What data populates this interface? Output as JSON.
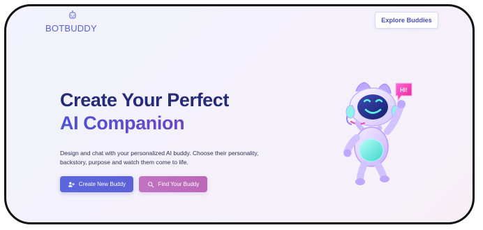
{
  "brand": {
    "name": "BOTBUDDY",
    "icon": "robot-head-icon"
  },
  "header": {
    "explore_label": "Explore Buddies"
  },
  "hero": {
    "title_line_1": "Create Your Perfect",
    "title_line_2": "AI Companion",
    "description": "Design and chat with your personalized AI buddy. Choose their personality, backstory, purpose and watch them come to life."
  },
  "actions": {
    "create_label": "Create New Buddy",
    "find_label": "Find Your Buddy",
    "create_icon": "user-plus-icon",
    "find_icon": "search-icon"
  },
  "illustration": {
    "speech_bubble_text": "HI!",
    "icon": "robot-icon"
  },
  "colors": {
    "brand": "#5b5fd3",
    "title_dark": "#262b77",
    "title_gradient_start": "#4b52d4",
    "title_gradient_end": "#8a43b8",
    "primary_button": "#5b66dd",
    "secondary_button": "#c173c2"
  }
}
